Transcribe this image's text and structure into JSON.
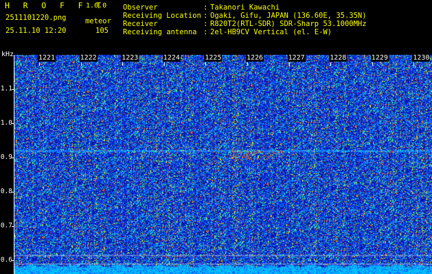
{
  "app": {
    "name": "H R O F F T",
    "version": "1.0.0"
  },
  "capture": {
    "filename": "2511101220.png",
    "timestamp": "25.11.10 12:20",
    "meteor_label": "meteor",
    "meteor_count": "105"
  },
  "station": {
    "rows": [
      {
        "label": "Observer",
        "value": "Takanori Kawachi"
      },
      {
        "label": "Receiving Location",
        "value": "Ogaki, Gifu, JAPAN (136.60E, 35.35N)"
      },
      {
        "label": "Receiver",
        "value": "R820T2(RTL-SDR) SDR-Sharp 53.1000MHz"
      },
      {
        "label": "Receiving antenna",
        "value": "2el-HB9CV Vertical (el. E-W)"
      }
    ]
  },
  "chart_data": {
    "type": "heatmap",
    "ylabel": "kHz",
    "y_ticks": [
      "1.1",
      "1.0",
      "0.9",
      "0.8",
      "0.7",
      "0.6"
    ],
    "x_ticks": [
      "1221",
      "1222",
      "1223",
      "1224",
      "1225",
      "1226",
      "1227",
      "1228",
      "1229",
      "1230"
    ],
    "colormap": [
      "#0010a0",
      "#1840ff",
      "#00c0ff",
      "#40ff80",
      "#ffff00",
      "#ff4000"
    ],
    "features": {
      "carrier_khz": 0.92,
      "bright_burst_minute": "1226"
    }
  }
}
